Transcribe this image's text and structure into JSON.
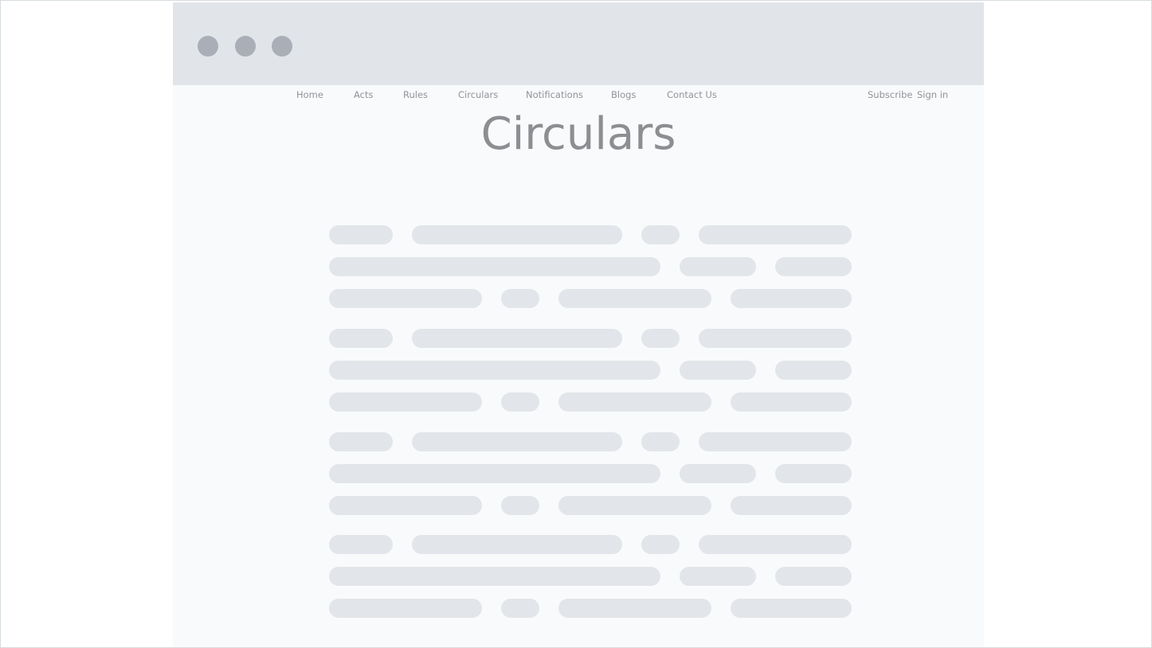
{
  "nav": {
    "home": "Home",
    "acts": "Acts",
    "rules": "Rules",
    "circulars": "Circulars",
    "notifications": "Notifications",
    "blogs": "Blogs",
    "contact_us": "Contact Us",
    "subscribe": "Subscribe",
    "sign_in": "Sign in"
  },
  "page": {
    "title": "Circulars"
  },
  "colors": {
    "title_bar": "#e1e5e9",
    "window_dots": "#a9aeb7",
    "page_background": "#f9fafb",
    "skeleton_placeholder": "#e2e5e9",
    "nav_text": "#8f949b",
    "title_text": "#8c8e92"
  }
}
